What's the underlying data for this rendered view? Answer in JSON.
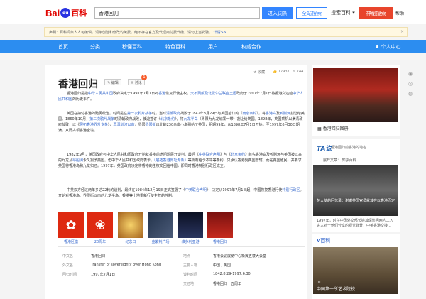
{
  "header": {
    "logo_bai": "Bai",
    "logo_du": "du",
    "logo_baike": "百科",
    "search_value": "香港回归",
    "enter_button": "进入词条",
    "web_search_button": "全站搜索",
    "scope_select": "搜索百科",
    "god_button": "神秘搜索",
    "help_link": "帮助"
  },
  "notice": {
    "text": "声明：百科词条人人可编辑，词条创建和修改均免费，绝不存在官方及代理商付费代编，请勿上当受骗。",
    "more_link": "详情>>",
    "close": "×"
  },
  "nav": {
    "items": [
      "首页",
      "分类",
      "秒懂百科",
      "特色百科",
      "用户",
      "权威合作"
    ],
    "user_center": "个人中心"
  },
  "article": {
    "title": "香港回归",
    "edit_tag": "编辑",
    "discuss_tag": "讨论",
    "discuss_count": "1",
    "stats": {
      "collect": "收藏",
      "like_count": "17937",
      "share_count": "744"
    },
    "p1_a": "香港回归是指",
    "p1_l1": "中华人民共和国",
    "p1_b": "政府决定于1997年7月1日对",
    "p1_l2": "香港",
    "p1_c": "恢复行使主权，",
    "p1_l3": "大不列颠及北爱尔兰联合王国",
    "p1_d": "政府于1997年7月1日将香港交还给",
    "p1_l4": "中华人民共和国",
    "p1_e": "的历史事件。",
    "p2_a": "英国在抽付香港的殖民统治。时间是在",
    "p2_l1": "第一次鸦片战争",
    "p2_b": "时，当时",
    "p2_l2": "清朝政府",
    "p2_c": "战败于1842年8月29日与英国签订的《",
    "p2_l3": "南京条约",
    "p2_d": "》，将",
    "p2_l4": "香港岛",
    "p2_e": "及",
    "p2_l5": "鸭脷洲",
    "p2_f": "割让给英国。1860年10月，",
    "p2_l6": "第二次鸦片战争",
    "p2_g": "时清朝政府战败，被迫签订《",
    "p2_l7": "北京条约",
    "p2_h": "》，将",
    "p2_l8": "九龙半岛",
    "p2_i": "（界限为九龙城寨一带）割让给英国。1898年，英国乘机以满清政府战败，以《",
    "p2_l9": "展拓香港界址专条",
    "p2_j": "》，",
    "p2_l10": "再深圳河以南",
    "p2_k": "，界限",
    "p2_l11": "界限街",
    "p2_l": "以北的230余座小岛租给了英国，租期99年，从1898年7月1日开始，至1997年6月30日期满，从而占领香港全境。",
    "p3_a": "1982年9月，英国政府与中华人民共和国政府开始就香港前途问题展开谈判。最后《",
    "p3_l1": "中英联合声明",
    "p3_b": "》与《",
    "p3_l2": "北京条约",
    "p3_c": "》首先香港岛及鸭脷洲与英国被以来的九龙及",
    "p3_l3": "昂船洲",
    "p3_d": "永久割予英国。但中华人民共和国政府表示，",
    "p3_l4": "《展拓香港界址专条》",
    "p3_e": "等所有给予不平等条约，只承认香港受英国管辖。而在英国殖民，并要求英国将香港岛和九龙归还。1997年，英国政府决定将香港的主权交回给中国，即同时香港特别行政区成立。",
    "p4_a": "中英双方经过两年多达22轮的谈判，最终在1984年12月19日正式签署了《",
    "p4_l1": "中英联合声明",
    "p4_b": "》，决定从1997年7月1日起，中国恢复香港行使",
    "p4_l2": "特别行政区",
    "p4_c": "。开始对香港岛、界限街以南的九龙半岛、香港等土地重新行使主权的控制。"
  },
  "gallery": {
    "items": [
      "香港区旗",
      "20周年",
      "纪念日",
      "金紫荆广场",
      "维多利亚港",
      "香港回归"
    ]
  },
  "infobox": {
    "rows": [
      {
        "label": "中文名",
        "value": "香港回归",
        "label2": "地点",
        "value2": "香港会议展览中心新翼五楼大会堂"
      },
      {
        "label": "外文名",
        "value": "Transfer of sovereignty over Hong Kong",
        "label2": "主要人物",
        "value2": "中国、英国"
      },
      {
        "label": "回归时间",
        "value": "1997年7月1日",
        "label2": "谈判时间",
        "value2": "1842.8.29-1997.6.30"
      },
      {
        "label": "",
        "value": "",
        "label2": "交还地",
        "value2": "香港回归十五周年"
      }
    ]
  },
  "sidebar": {
    "caption1": "香港回归图册",
    "taishuo_logo": "TA说",
    "taishuo_sub": "香港回归前香港的地名",
    "taishuo_author": "展开文章：  知乎百科",
    "caption2": "萨大使的回忆录：谢谢英国官员就其在以香港而定",
    "text2": "1997年，时任中国外交部长钱其琛访问两人工入进入对于他们分享的视觉背景，中英香港交接...",
    "vbk": "V百科",
    "vbk_num": "01",
    "caption3": "中国第一所艺术院校"
  },
  "icons": {
    "edit": "pencil-icon",
    "discuss": "chat-icon",
    "star": "star-icon",
    "thumb": "thumb-up-icon",
    "share": "share-icon",
    "user": "user-icon"
  },
  "colors": {
    "brand_blue": "#3385ff",
    "nav_blue": "#2c8df0",
    "accent_red": "#e8452c",
    "link": "#3366cc"
  }
}
